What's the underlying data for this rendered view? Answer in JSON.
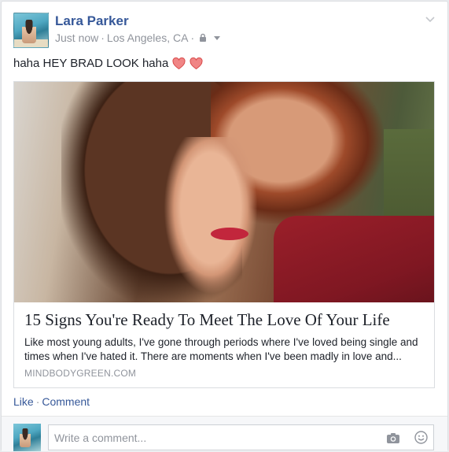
{
  "post": {
    "author": "Lara Parker",
    "time": "Just now",
    "separator": " · ",
    "location": "Los Angeles, CA",
    "separator2": " ·",
    "status_text": "haha HEY BRAD LOOK haha",
    "hearts": [
      "heart-icon",
      "heart-icon"
    ],
    "heart_color": "#e55a5a"
  },
  "link": {
    "title": "15 Signs You're Ready To Meet The Love Of Your Life",
    "description": "Like most young adults, I've gone through periods where I've loved being single and times when I've hated it. There are moments when I've been madly in love and...",
    "domain": "MINDBODYGREEN.COM"
  },
  "actions": {
    "like": "Like",
    "dot": "·",
    "comment": "Comment"
  },
  "comment": {
    "placeholder": "Write a comment..."
  },
  "colors": {
    "link_blue": "#365899",
    "meta_gray": "#90949c"
  }
}
